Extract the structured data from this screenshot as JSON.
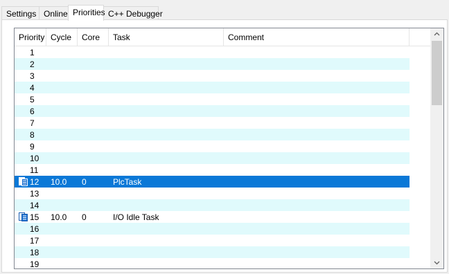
{
  "tabs": [
    {
      "label": "Settings"
    },
    {
      "label": "Online"
    },
    {
      "label": "Priorities"
    },
    {
      "label": "C++ Debugger"
    }
  ],
  "active_tab": "Priorities",
  "grid": {
    "columns": [
      "Priority",
      "Cycle",
      "Core",
      "Task",
      "Comment"
    ],
    "rows": [
      {
        "priority": "1"
      },
      {
        "priority": "2"
      },
      {
        "priority": "3"
      },
      {
        "priority": "4"
      },
      {
        "priority": "5"
      },
      {
        "priority": "6"
      },
      {
        "priority": "7"
      },
      {
        "priority": "8"
      },
      {
        "priority": "9"
      },
      {
        "priority": "10"
      },
      {
        "priority": "11"
      },
      {
        "priority": "12",
        "cycle": "10.0",
        "core": "0",
        "task": "PlcTask",
        "icon": "task-icon",
        "selected": true
      },
      {
        "priority": "13"
      },
      {
        "priority": "14"
      },
      {
        "priority": "15",
        "cycle": "10.0",
        "core": "0",
        "task": "I/O Idle Task",
        "icon": "task-icon"
      },
      {
        "priority": "16"
      },
      {
        "priority": "17"
      },
      {
        "priority": "18"
      },
      {
        "priority": "19"
      }
    ]
  },
  "colors": {
    "selection": "#0a78d7",
    "alt_row": "#e0fafc"
  }
}
